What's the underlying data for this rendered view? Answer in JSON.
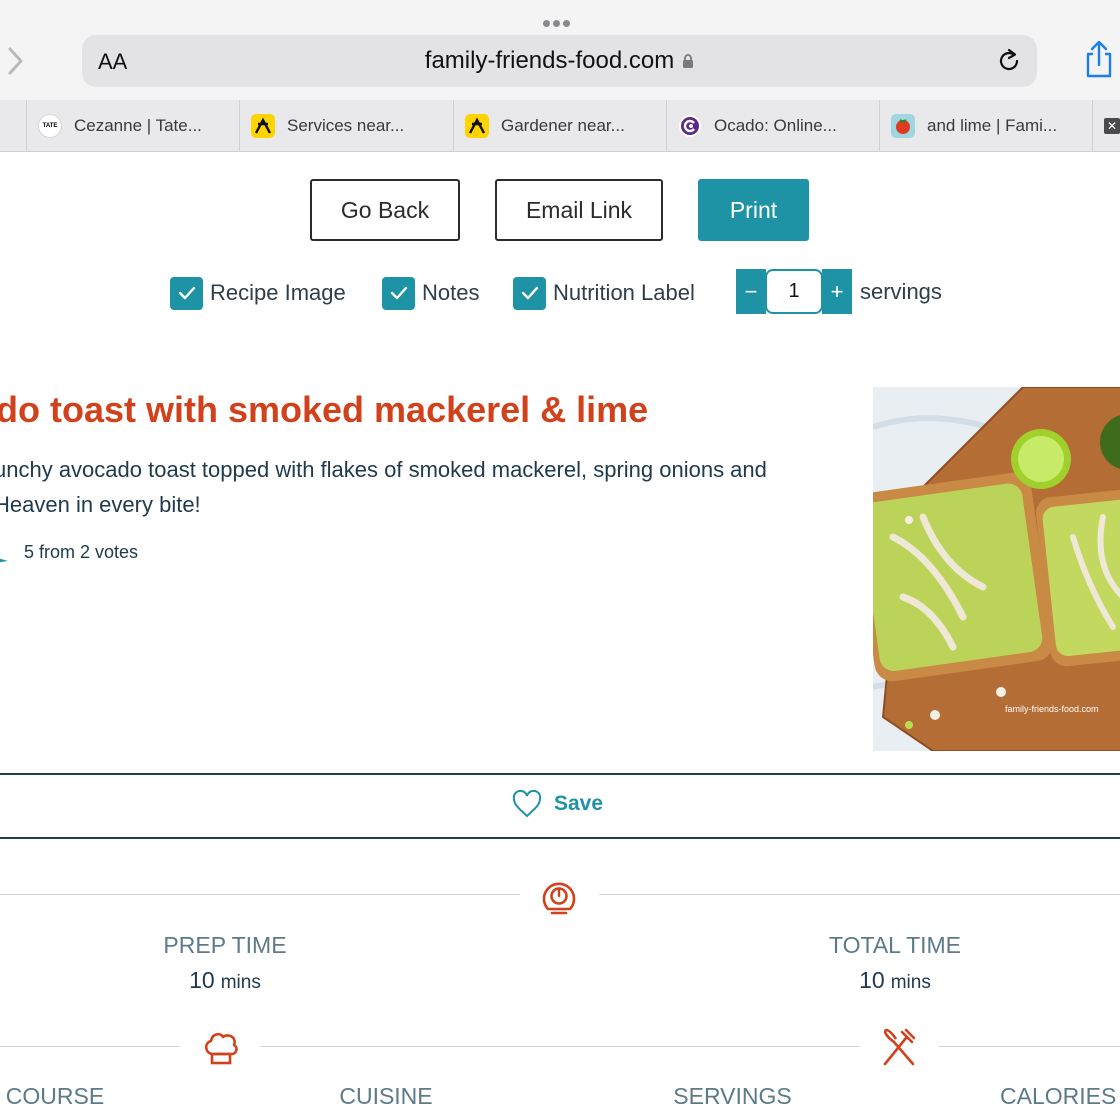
{
  "browser": {
    "text_size_label": "AA",
    "url": "family-friends-food.com",
    "tabs": [
      {
        "label": "Cezanne | Tate...",
        "icon": "tate-favicon"
      },
      {
        "label": "Services near...",
        "icon": "yell-favicon"
      },
      {
        "label": "Gardener near...",
        "icon": "yell-favicon"
      },
      {
        "label": "Ocado: Online...",
        "icon": "ocado-favicon"
      },
      {
        "label": "and lime | Fami...",
        "icon": "tomato-favicon"
      }
    ],
    "tate_badge": "TATE"
  },
  "actions": {
    "go_back": "Go Back",
    "email_link": "Email Link",
    "print": "Print"
  },
  "print_options": {
    "recipe_image": "Recipe Image",
    "notes": "Notes",
    "nutrition_label": "Nutrition Label",
    "minus": "−",
    "plus": "+",
    "servings_value": "1",
    "servings_label": "servings"
  },
  "recipe": {
    "title": "do toast with smoked mackerel & lime",
    "summary_line1": "unchy avocado toast topped with flakes of smoked mackerel, spring onions and",
    "summary_line2": "Heaven in every bite!",
    "rating": "5 from 2 votes",
    "image_watermark": "family-friends-food.com",
    "save": "Save"
  },
  "times": {
    "prep_label": "PREP TIME",
    "prep_value": "10",
    "prep_unit": "mins",
    "total_label": "TOTAL TIME",
    "total_value": "10",
    "total_unit": "mins"
  },
  "details": {
    "course": "COURSE",
    "cuisine": "CUISINE",
    "servings": "SERVINGS",
    "calories": "CALORIES"
  },
  "colors": {
    "accent": "#1f93a6",
    "title_red": "#d1411c",
    "text_dark": "#1e3a4c",
    "muted": "#5d7a89"
  }
}
